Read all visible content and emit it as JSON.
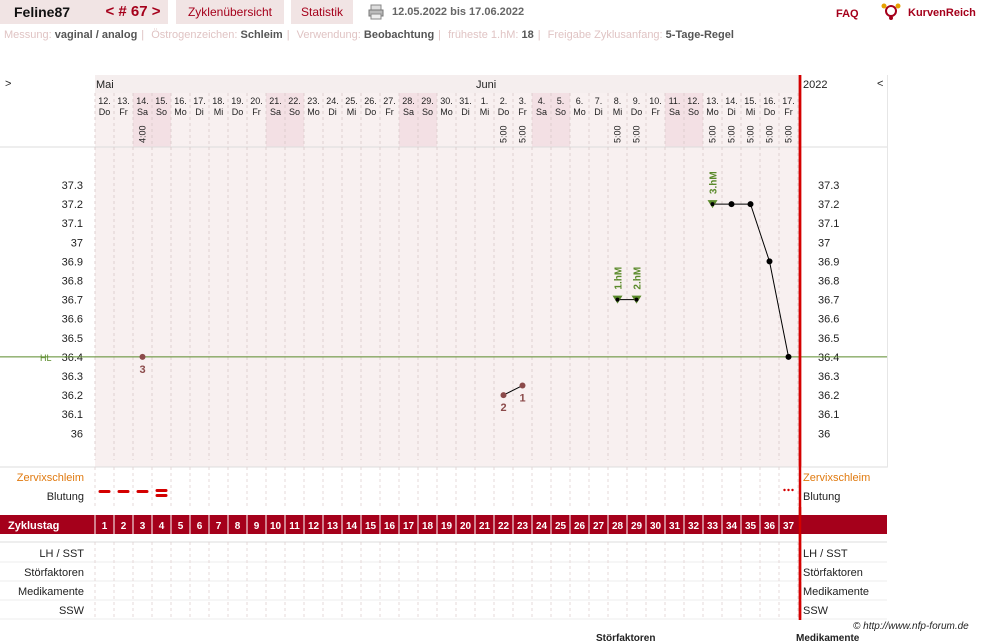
{
  "header": {
    "username": "Feline87",
    "cycle_nav": "< # 67 >",
    "overview_label": "Zyklenübersicht",
    "stats_label": "Statistik",
    "date_range": "12.05.2022 bis 17.06.2022",
    "faq": "FAQ",
    "logo_text": "KurvenReich"
  },
  "infobar": {
    "measure_label": "Messung:",
    "measure_value": "vaginal / analog",
    "estrogen_label": "Östrogenzeichen:",
    "estrogen_value": "Schleim",
    "usage_label": "Verwendung:",
    "usage_value": "Beobachtung",
    "earliest_label": "früheste 1.hM:",
    "earliest_value": "18",
    "release_label": "Freigabe Zyklusanfang:",
    "release_value": "5-Tage-Regel"
  },
  "nav": {
    "left_arrow": ">",
    "right_arrow": "<",
    "year": "2022"
  },
  "months": [
    {
      "label": "Mai",
      "day": 1
    },
    {
      "label": "Juni",
      "day": 21
    }
  ],
  "chart_data": {
    "type": "line",
    "cycle_days": [
      1,
      2,
      3,
      4,
      5,
      6,
      7,
      8,
      9,
      10,
      11,
      12,
      13,
      14,
      15,
      16,
      17,
      18,
      19,
      20,
      21,
      22,
      23,
      24,
      25,
      26,
      27,
      28,
      29,
      30,
      31,
      32,
      33,
      34,
      35,
      36,
      37
    ],
    "dates": [
      "12.",
      "13.",
      "14.",
      "15.",
      "16.",
      "17.",
      "18.",
      "19.",
      "20.",
      "21.",
      "22.",
      "23.",
      "24.",
      "25.",
      "26.",
      "27.",
      "28.",
      "29.",
      "30.",
      "31.",
      "1.",
      "2.",
      "3.",
      "4.",
      "5.",
      "6.",
      "7.",
      "8.",
      "9.",
      "10.",
      "11.",
      "12.",
      "13.",
      "14.",
      "15.",
      "16.",
      "17."
    ],
    "weekdays": [
      "Do",
      "Fr",
      "Sa",
      "So",
      "Mo",
      "Di",
      "Mi",
      "Do",
      "Fr",
      "Sa",
      "So",
      "Mo",
      "Di",
      "Mi",
      "Do",
      "Fr",
      "Sa",
      "So",
      "Mo",
      "Di",
      "Mi",
      "Do",
      "Fr",
      "Sa",
      "So",
      "Mo",
      "Di",
      "Mi",
      "Do",
      "Fr",
      "Sa",
      "So",
      "Mo",
      "Di",
      "Mi",
      "Do",
      "Fr"
    ],
    "weekend_days": [
      3,
      4,
      10,
      11,
      17,
      18,
      24,
      25,
      31,
      32
    ],
    "times": [
      {
        "day": 3,
        "time": "4:00"
      },
      {
        "day": 22,
        "time": "5:00"
      },
      {
        "day": 23,
        "time": "5:00"
      },
      {
        "day": 28,
        "time": "5:00"
      },
      {
        "day": 29,
        "time": "5:00"
      },
      {
        "day": 33,
        "time": "5:00"
      },
      {
        "day": 34,
        "time": "5:00"
      },
      {
        "day": 35,
        "time": "5:00"
      },
      {
        "day": 36,
        "time": "5:00"
      },
      {
        "day": 37,
        "time": "5:00"
      }
    ],
    "y_ticks": [
      "37.3",
      "37.2",
      "37.1",
      "37",
      "36.9",
      "36.8",
      "36.7",
      "36.6",
      "36.5",
      "36.4",
      "36.3",
      "36.2",
      "36.1",
      "36"
    ],
    "ylim": [
      36.0,
      37.3
    ],
    "hl_label": "HL",
    "hl_value": 36.4,
    "temperatures": [
      {
        "day": 3,
        "value": 36.4,
        "label": "3"
      },
      {
        "day": 22,
        "value": 36.2,
        "label": "2"
      },
      {
        "day": 23,
        "value": 36.25,
        "label": "1"
      },
      {
        "day": 28,
        "value": 36.7,
        "marker": "1.hM"
      },
      {
        "day": 29,
        "value": 36.7,
        "marker": "2.hM"
      },
      {
        "day": 33,
        "value": 37.2,
        "marker": "3.hM"
      },
      {
        "day": 34,
        "value": 37.2
      },
      {
        "day": 35,
        "value": 37.2
      },
      {
        "day": 36,
        "value": 36.9
      },
      {
        "day": 37,
        "value": 36.4
      }
    ],
    "segments": [
      [
        22,
        23
      ],
      [
        28,
        29
      ],
      [
        33,
        34
      ],
      [
        34,
        35
      ],
      [
        35,
        36
      ],
      [
        36,
        37
      ]
    ],
    "bleeding": [
      {
        "day": 1,
        "style": "dash"
      },
      {
        "day": 2,
        "style": "dash"
      },
      {
        "day": 3,
        "style": "dash"
      },
      {
        "day": 4,
        "style": "double"
      },
      {
        "day": 37,
        "style": "dots"
      }
    ],
    "line_color": "#000000",
    "point_color": "#8b4a4a",
    "hm_color": "#5a8a2a"
  },
  "rows": {
    "cervix": "Zervixschleim",
    "bleeding": "Blutung",
    "cycle_day": "Zyklustag",
    "lh": "LH / SST",
    "disturbances": "Störfaktoren",
    "medication": "Medikamente",
    "ssw": "SSW"
  },
  "footer": {
    "copyright": "© http://www.nfp-forum.de",
    "cut1": "Störfaktoren",
    "cut2": "Medikamente"
  },
  "colors": {
    "brand": "#a5001b",
    "weekend": "#f3e0e4",
    "grid": "#f8f0f0",
    "hl": "#5a8a2a"
  }
}
